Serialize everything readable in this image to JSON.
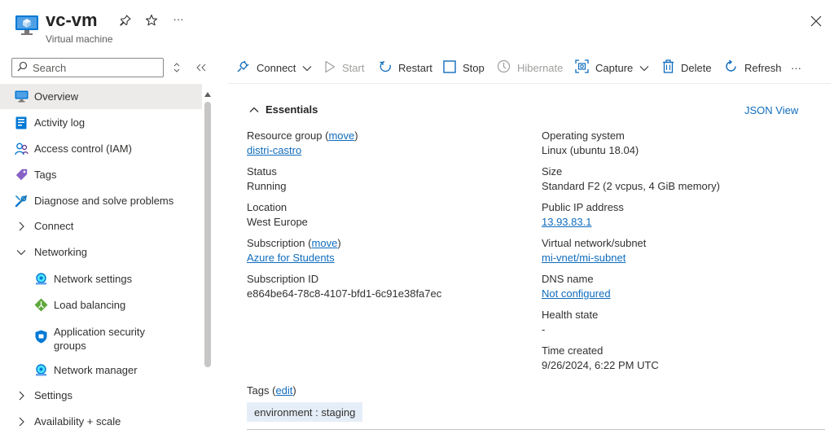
{
  "header": {
    "title": "vc-vm",
    "subtitle": "Virtual machine",
    "more": "···"
  },
  "sidebar": {
    "search": {
      "placeholder": "Search",
      "value": ""
    },
    "items": [
      {
        "label": "Overview",
        "icon": "monitor-icon"
      },
      {
        "label": "Activity log",
        "icon": "activity-log-icon"
      },
      {
        "label": "Access control (IAM)",
        "icon": "users-icon"
      },
      {
        "label": "Tags",
        "icon": "tag-icon"
      },
      {
        "label": "Diagnose and solve problems",
        "icon": "wrench-icon"
      },
      {
        "label": "Connect",
        "icon": "chevron-right-icon"
      },
      {
        "label": "Networking",
        "icon": "chevron-down-icon"
      },
      {
        "label": "Network settings",
        "icon": "network-settings-icon"
      },
      {
        "label": "Load balancing",
        "icon": "load-balancer-icon"
      },
      {
        "label": "Application security groups",
        "icon": "shield-icon"
      },
      {
        "label": "Network manager",
        "icon": "network-manager-icon"
      },
      {
        "label": "Settings",
        "icon": "chevron-right-icon"
      },
      {
        "label": "Availability + scale",
        "icon": "chevron-right-icon"
      }
    ],
    "app_security_line1": "Application security",
    "app_security_line2": "groups"
  },
  "toolbar": {
    "connect": "Connect",
    "start": "Start",
    "restart": "Restart",
    "stop": "Stop",
    "hibernate": "Hibernate",
    "capture": "Capture",
    "delete": "Delete",
    "refresh": "Refresh",
    "more": "···"
  },
  "essentials": {
    "title": "Essentials",
    "json_view": "JSON View",
    "left": {
      "resource_group_label": "Resource group",
      "move_link": "move",
      "resource_group_value": "distri-castro",
      "status_label": "Status",
      "status_value": "Running",
      "location_label": "Location",
      "location_value": "West Europe",
      "subscription_label": "Subscription",
      "subscription_value": "Azure for Students",
      "subscription_id_label": "Subscription ID",
      "subscription_id_value": "e864be64-78c8-4107-bfd1-6c91e38fa7ec"
    },
    "right": {
      "os_label": "Operating system",
      "os_value": "Linux (ubuntu 18.04)",
      "size_label": "Size",
      "size_value": "Standard F2 (2 vcpus, 4 GiB memory)",
      "public_ip_label": "Public IP address",
      "public_ip_value": "13.93.83.1",
      "vnet_label": "Virtual network/subnet",
      "vnet_value": "mi-vnet/mi-subnet",
      "dns_label": "DNS name",
      "dns_value": "Not configured",
      "health_label": "Health state",
      "health_value": "-",
      "time_label": "Time created",
      "time_value": "9/26/2024, 6:22 PM UTC"
    },
    "tags_label": "Tags",
    "tags_edit": "edit",
    "tag_chip": "environment : staging"
  },
  "colors": {
    "accent": "#0f6cbd",
    "selected_bg": "#edebe9",
    "tag_bg": "#e5eef8"
  }
}
